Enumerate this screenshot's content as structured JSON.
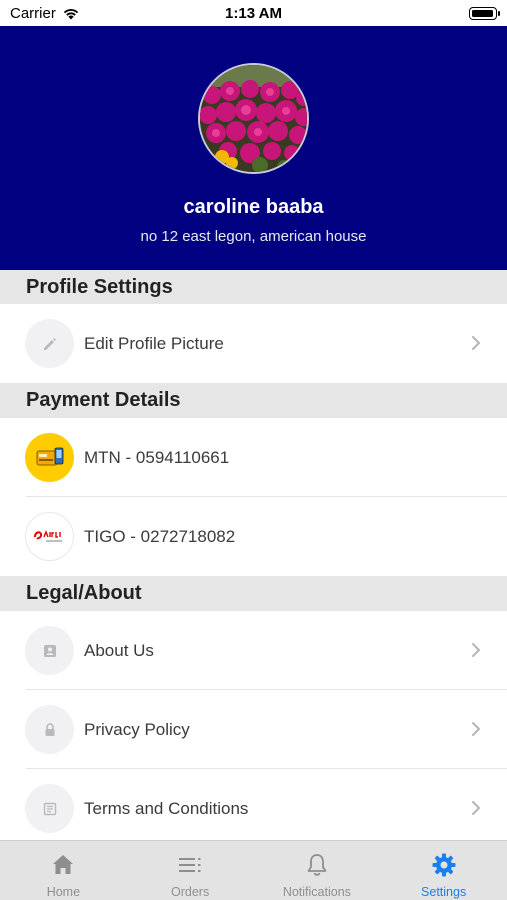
{
  "status_bar": {
    "carrier": "Carrier",
    "time": "1:13 AM"
  },
  "profile": {
    "name": "caroline baaba",
    "address": "no 12 east legon, american house"
  },
  "sections": {
    "profile_settings": {
      "title": "Profile Settings",
      "items": [
        {
          "label": "Edit Profile Picture",
          "icon": "pencil-icon"
        }
      ]
    },
    "payment_details": {
      "title": "Payment Details",
      "items": [
        {
          "label": "MTN - 0594110661",
          "icon": "mtn-momo-logo"
        },
        {
          "label": "TIGO - 0272718082",
          "icon": "airtel-money-logo"
        }
      ]
    },
    "legal_about": {
      "title": "Legal/About",
      "items": [
        {
          "label": "About Us",
          "icon": "id-card-icon"
        },
        {
          "label": "Privacy Policy",
          "icon": "lock-icon"
        },
        {
          "label": "Terms and Conditions",
          "icon": "document-icon"
        }
      ]
    }
  },
  "tab_bar": {
    "tabs": [
      {
        "label": "Home",
        "icon": "home-icon"
      },
      {
        "label": "Orders",
        "icon": "list-icon"
      },
      {
        "label": "Notifications",
        "icon": "bell-icon"
      },
      {
        "label": "Settings",
        "icon": "gear-icon"
      }
    ],
    "active": "Settings"
  },
  "colors": {
    "header_bg": "#000080",
    "section_bg": "#e6e6e6",
    "accent": "#1a7ff0",
    "mtn_yellow": "#ffcc00",
    "airtel_red": "#e40000"
  }
}
